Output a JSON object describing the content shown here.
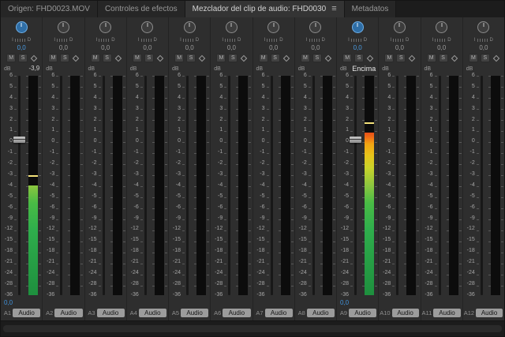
{
  "tabs": [
    {
      "label": "Origen: FHD0023.MOV",
      "active": false
    },
    {
      "label": "Controles de efectos",
      "active": false
    },
    {
      "label": "Mezclador del clip de audio: FHD0030",
      "active": true,
      "menu_icon": "≡"
    },
    {
      "label": "Metadatos",
      "active": false
    }
  ],
  "mixer": {
    "pan_left": "I",
    "pan_right": "D",
    "mute": "M",
    "solo": "S",
    "db_label": "dB",
    "scale": [
      "6",
      "5",
      "4",
      "3",
      "2",
      "1",
      "0",
      "-1",
      "-2",
      "-3",
      "-4",
      "-5",
      "-6",
      "-9",
      "-12",
      "-15",
      "-18",
      "-21",
      "-24",
      "-28",
      "-36"
    ],
    "channels": [
      {
        "id": "A1",
        "name": "Audio",
        "pan": "0,0",
        "active": true,
        "top_value": "-3,9",
        "volume": "0,0",
        "fader_pct": 29,
        "meter": {
          "fill_pct": 50,
          "peak_pct": 54
        }
      },
      {
        "id": "A2",
        "name": "Audio",
        "pan": "0,0",
        "active": false
      },
      {
        "id": "A3",
        "name": "Audio",
        "pan": "0,0",
        "active": false
      },
      {
        "id": "A4",
        "name": "Audio",
        "pan": "0,0",
        "active": false
      },
      {
        "id": "A5",
        "name": "Audio",
        "pan": "0,0",
        "active": false
      },
      {
        "id": "A6",
        "name": "Audio",
        "pan": "0,0",
        "active": false
      },
      {
        "id": "A7",
        "name": "Audio",
        "pan": "0,0",
        "active": false
      },
      {
        "id": "A8",
        "name": "Audio",
        "pan": "0,0",
        "active": false
      },
      {
        "id": "A9",
        "name": "Audio",
        "pan": "0,0",
        "active": true,
        "top_value": "Encima",
        "tooltip": true,
        "volume": "0,0",
        "fader_pct": 29,
        "meter": {
          "fill_pct": 74,
          "peak_pct": 78
        }
      },
      {
        "id": "A10",
        "name": "Audio",
        "pan": "0,0",
        "active": false
      },
      {
        "id": "A11",
        "name": "Audio",
        "pan": "0,0",
        "active": false
      },
      {
        "id": "A12",
        "name": "Audio",
        "pan": "0,0",
        "active": false
      }
    ]
  },
  "colors": {
    "accent_blue": "#3f8fd6",
    "meter_green": "#2fae4c",
    "meter_yellow": "#e8c219",
    "meter_orange": "#f2a312",
    "meter_red": "#d61f1f",
    "panel_bg": "#2e2e2e",
    "meter_bg": "#0c0c0c"
  }
}
